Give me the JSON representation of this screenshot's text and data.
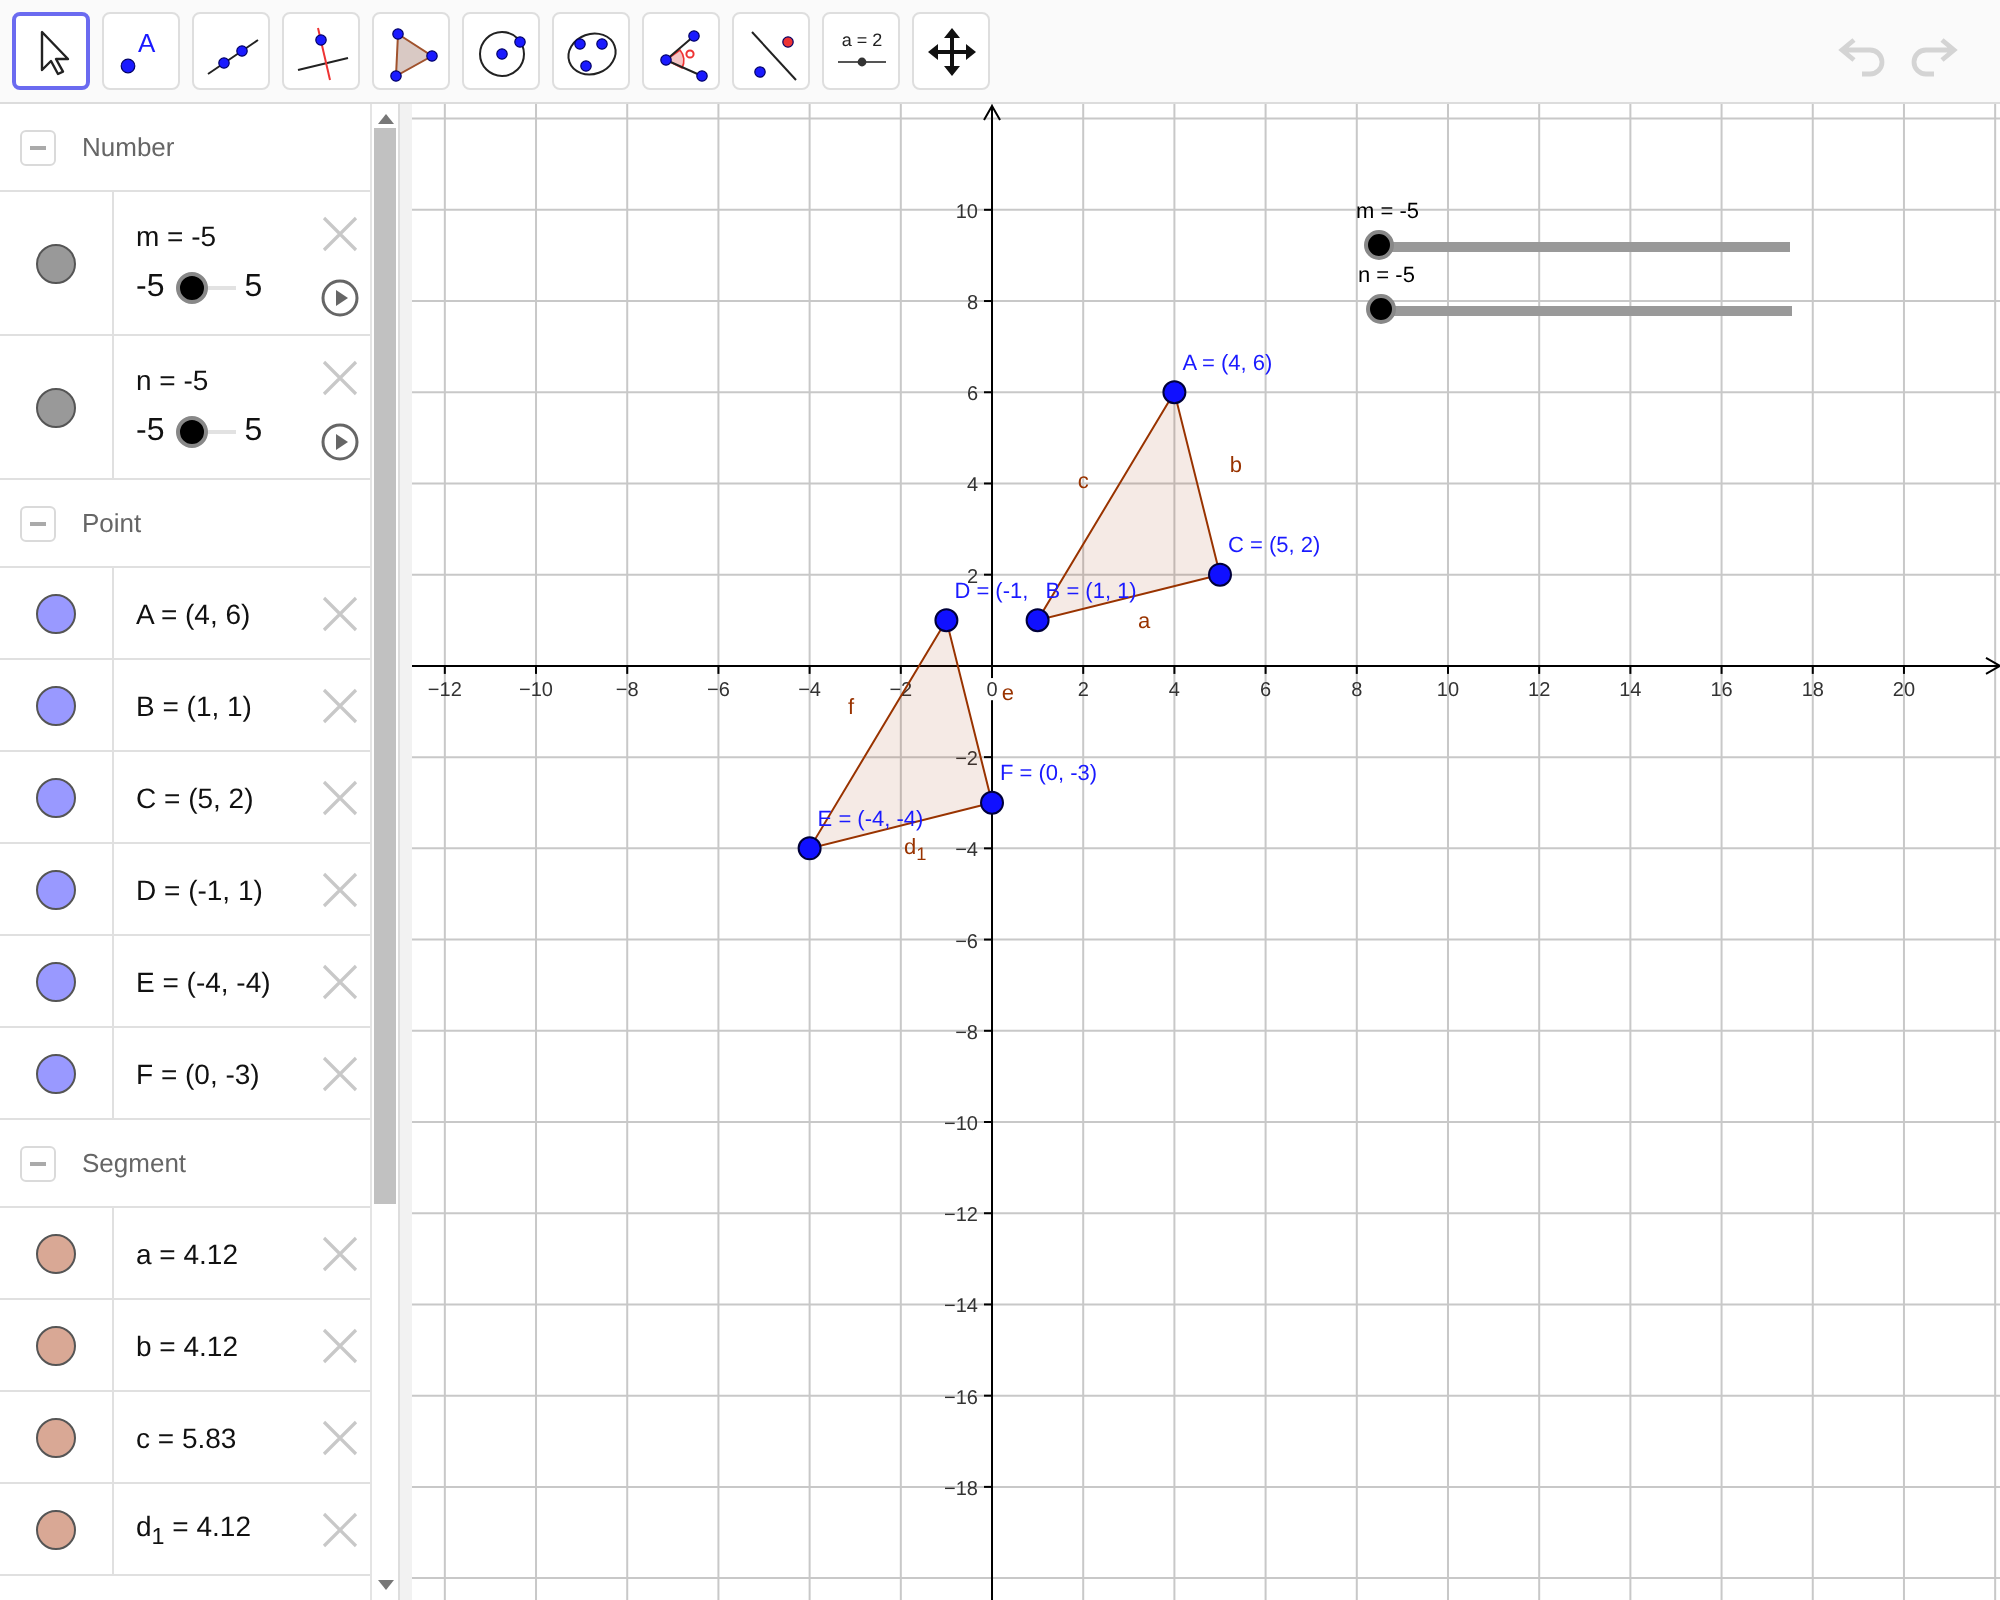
{
  "toolbar": {
    "tools": [
      {
        "kind": "move",
        "selected": true
      },
      {
        "kind": "point",
        "label": "A",
        "selected": false
      },
      {
        "kind": "line",
        "selected": false
      },
      {
        "kind": "perpendicular",
        "selected": false
      },
      {
        "kind": "polygon",
        "selected": false
      },
      {
        "kind": "circle",
        "selected": false
      },
      {
        "kind": "conic",
        "selected": false
      },
      {
        "kind": "angle",
        "selected": false
      },
      {
        "kind": "reflect",
        "selected": false
      },
      {
        "kind": "slider",
        "label": "a = 2",
        "selected": false
      },
      {
        "kind": "pan",
        "selected": false
      }
    ],
    "undo": {
      "disabled": true
    },
    "redo": {
      "disabled": true
    }
  },
  "algebra": {
    "groups": [
      {
        "title": "Number",
        "expanded": true,
        "items": [
          {
            "kind": "slider",
            "text": "m = -5",
            "min": "-5",
            "max": "5",
            "level": 0,
            "color": "#999999"
          },
          {
            "kind": "slider",
            "text": "n = -5",
            "min": "-5",
            "max": "5",
            "level": 0,
            "color": "#999999"
          }
        ]
      },
      {
        "title": "Point",
        "expanded": true,
        "items": [
          {
            "kind": "value",
            "text": "A = (4, 6)",
            "color": "#9999ff"
          },
          {
            "kind": "value",
            "text": "B = (1, 1)",
            "color": "#9999ff"
          },
          {
            "kind": "value",
            "text": "C = (5, 2)",
            "color": "#9999ff"
          },
          {
            "kind": "value",
            "text": "D = (-1, 1)",
            "color": "#9999ff"
          },
          {
            "kind": "value",
            "text": "E = (-4, -4)",
            "color": "#9999ff"
          },
          {
            "kind": "value",
            "text": "F = (0, -3)",
            "color": "#9999ff"
          }
        ]
      },
      {
        "title": "Segment",
        "expanded": true,
        "items": [
          {
            "kind": "value",
            "text": "a = 4.12",
            "color": "#d9a895"
          },
          {
            "kind": "value",
            "text": "b = 4.12",
            "color": "#d9a895"
          },
          {
            "kind": "value",
            "text": "c = 5.83",
            "color": "#d9a895"
          },
          {
            "kind": "value",
            "text": "d$_{1}$ = 4.12",
            "color": "#d9a895"
          }
        ]
      }
    ]
  },
  "graphics": {
    "sliders": [
      {
        "label": "m = -5",
        "level": 0
      },
      {
        "label": "n = -5",
        "level": 0
      }
    ],
    "chart_data": {
      "type": "scatter",
      "xlim": [
        -12.72,
        22.15
      ],
      "ylim": [
        -20.48,
        12.32
      ],
      "xticks": [
        {
          "value": -12,
          "label": "−12"
        },
        {
          "value": -10,
          "label": "−10"
        },
        {
          "value": -8,
          "label": "−8"
        },
        {
          "value": -6,
          "label": "−6"
        },
        {
          "value": -4,
          "label": "−4"
        },
        {
          "value": -2,
          "label": "−2"
        },
        0,
        2,
        4,
        6,
        8,
        10,
        12,
        14,
        16,
        18,
        20
      ],
      "yticks": [
        10,
        8,
        6,
        4,
        2,
        {
          "value": -2,
          "label": "−2"
        },
        {
          "value": -4,
          "label": "−4"
        },
        {
          "value": -6,
          "label": "−6"
        },
        {
          "value": -8,
          "label": "−8"
        },
        {
          "value": -10,
          "label": "−10"
        },
        {
          "value": -12,
          "label": "−12"
        },
        {
          "value": -14,
          "label": "−14"
        },
        {
          "value": -16,
          "label": "−16"
        },
        {
          "value": -18,
          "label": "−18"
        }
      ],
      "x": [
        4,
        1,
        5,
        -1,
        -4,
        0
      ],
      "series": [
        {
          "color": "#1010ff",
          "values": [
            6,
            1,
            2,
            null,
            null,
            null
          ]
        },
        {
          "color": "#1010ff",
          "values": [
            null,
            null,
            null,
            1,
            -4,
            -3
          ]
        }
      ],
      "grid": true,
      "annotations": [
        {
          "text": "A = (4, 6)",
          "x": 4,
          "y": 6
        },
        {
          "text": "D = (-1,",
          "x": -1,
          "y": 1
        },
        {
          "text": "B = (1, 1)",
          "x": 1,
          "y": 1
        },
        {
          "text": "C = (5, 2)",
          "x": 5,
          "y": 2
        },
        {
          "text": "E = (-4, -4)",
          "x": -4,
          "y": -4
        },
        {
          "text": "F = (0, -3)",
          "x": 0,
          "y": -3
        },
        {
          "text": "c"
        },
        {
          "text": "b"
        },
        {
          "text": "a"
        },
        {
          "text": "f"
        },
        {
          "text": "e"
        },
        {
          "text": "d$_{1}$"
        }
      ]
    }
  }
}
